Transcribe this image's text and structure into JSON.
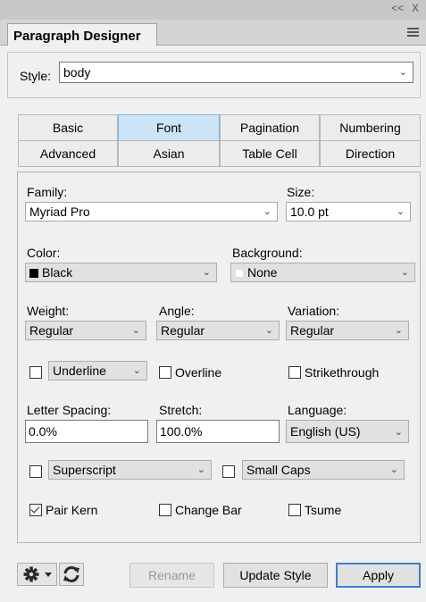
{
  "window": {
    "collapse_glyph": "<<",
    "close_glyph": "X"
  },
  "panel": {
    "title": "Paragraph Designer",
    "menu_icon": "hamburger-menu-icon"
  },
  "style": {
    "label": "Style:",
    "value": "body"
  },
  "tabs": {
    "row1": [
      "Basic",
      "Font",
      "Pagination",
      "Numbering"
    ],
    "row2": [
      "Advanced",
      "Asian",
      "Table Cell",
      "Direction"
    ],
    "active": "Font"
  },
  "font": {
    "family": {
      "label": "Family:",
      "value": "Myriad Pro"
    },
    "size": {
      "label": "Size:",
      "value": "10.0 pt"
    },
    "color": {
      "label": "Color:",
      "value": "Black",
      "swatch": "#000000"
    },
    "background": {
      "label": "Background:",
      "value": "None",
      "swatch": "#ffffff"
    },
    "weight": {
      "label": "Weight:",
      "value": "Regular"
    },
    "angle": {
      "label": "Angle:",
      "value": "Regular"
    },
    "variation": {
      "label": "Variation:",
      "value": "Regular"
    },
    "underline": {
      "checked": false,
      "value": "Underline"
    },
    "overline": {
      "checked": false,
      "label": "Overline"
    },
    "strikethrough": {
      "checked": false,
      "label": "Strikethrough"
    },
    "letter_spacing": {
      "label": "Letter Spacing:",
      "value": "0.0%"
    },
    "stretch": {
      "label": "Stretch:",
      "value": "100.0%"
    },
    "language": {
      "label": "Language:",
      "value": "English (US)"
    },
    "superscript": {
      "checked": false,
      "value": "Superscript"
    },
    "small_caps": {
      "checked": false,
      "value": "Small Caps"
    },
    "pair_kern": {
      "checked": true,
      "label": "Pair Kern"
    },
    "change_bar": {
      "checked": false,
      "label": "Change Bar"
    },
    "tsume": {
      "checked": false,
      "label": "Tsume"
    }
  },
  "buttons": {
    "rename": "Rename",
    "update_style": "Update Style",
    "apply": "Apply"
  },
  "colors": {
    "active_tab": "#cce4f7",
    "apply_border": "#3c7fd2"
  }
}
